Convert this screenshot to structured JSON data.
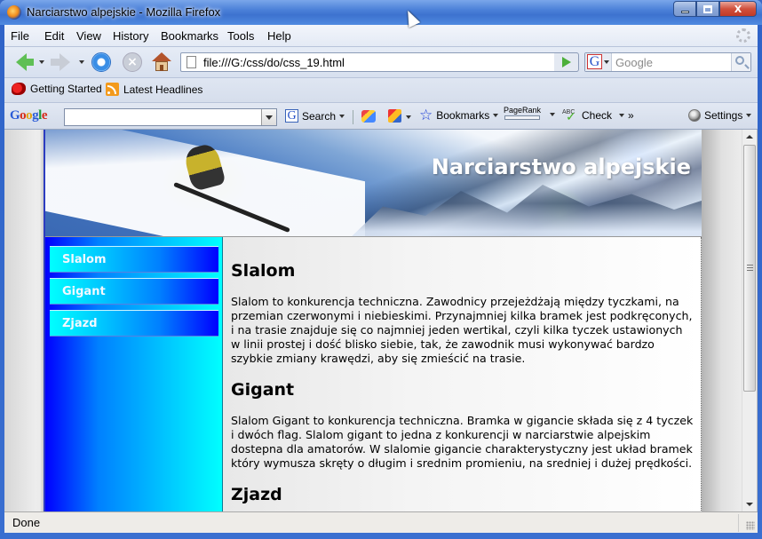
{
  "window": {
    "title": "Narciarstwo alpejskie - Mozilla Firefox",
    "controls": {
      "minimize": "minimize",
      "maximize": "maximize",
      "close": "X"
    }
  },
  "menu": {
    "items": [
      "File",
      "Edit",
      "View",
      "History",
      "Bookmarks",
      "Tools",
      "Help"
    ]
  },
  "navigation": {
    "url": "file:///G:/css/do/css_19.html",
    "search_placeholder": "Google",
    "search_engine_glyph": "G",
    "icons": [
      "back-icon",
      "forward-icon",
      "reload-icon",
      "stop-icon",
      "home-icon"
    ]
  },
  "bookmarks_bar": {
    "items": [
      {
        "label": "Getting Started",
        "icon": "getting-started-icon"
      },
      {
        "label": "Latest Headlines",
        "icon": "rss-icon"
      }
    ]
  },
  "google_toolbar": {
    "logo": [
      "G",
      "o",
      "o",
      "g",
      "l",
      "e"
    ],
    "search_value": "",
    "search_label": "Search",
    "bookmarks_label": "Bookmarks",
    "pagerank_label": "PageRank",
    "check_label": "Check",
    "more_label": "»",
    "settings_label": "Settings",
    "abc_label": "ABC",
    "stop_glyph": "×",
    "g_glyph": "G",
    "star_glyph": "☆"
  },
  "page": {
    "site_title": "Narciarstwo alpejskie",
    "nav_links": [
      "Slalom",
      "Gigant",
      "Zjazd"
    ],
    "sections": [
      {
        "heading": "Slalom",
        "text": "Slalom to konkurencja techniczna. Zawodnicy przejeżdżają między tyczkami, na przemian czerwonymi i niebieskimi. Przynajmniej kilka bramek jest podkręconych, i na trasie znajduje się co najmniej jeden wertikal, czyli kilka tyczek ustawionych w linii prostej i dość blisko siebie, tak, że zawodnik musi wykonywać bardzo szybkie zmiany krawędzi, aby się zmieścić na trasie."
      },
      {
        "heading": "Gigant",
        "text": "Slalom Gigant to konkurencja techniczna. Bramka w gigancie składa się z 4 tyczek i dwóch flag. Slalom gigant to jedna z konkurencji w narciarstwie alpejskim dostepna dla amatorów. W slalomie gigancie charakterystyczny jest układ bramek który wymusza skręty o długim i srednim promieniu, na sredniej i dużej prędkości."
      },
      {
        "heading": "Zjazd",
        "text": ""
      }
    ],
    "colors": {
      "sidebar_gradient": [
        "#0000ff",
        "#00ffff"
      ],
      "nav_gradient": [
        "#00ffff",
        "#0000ff"
      ],
      "nav_text": "#f4f8ff",
      "page_border": "#2c3cc0"
    }
  },
  "status": {
    "text": "Done"
  }
}
